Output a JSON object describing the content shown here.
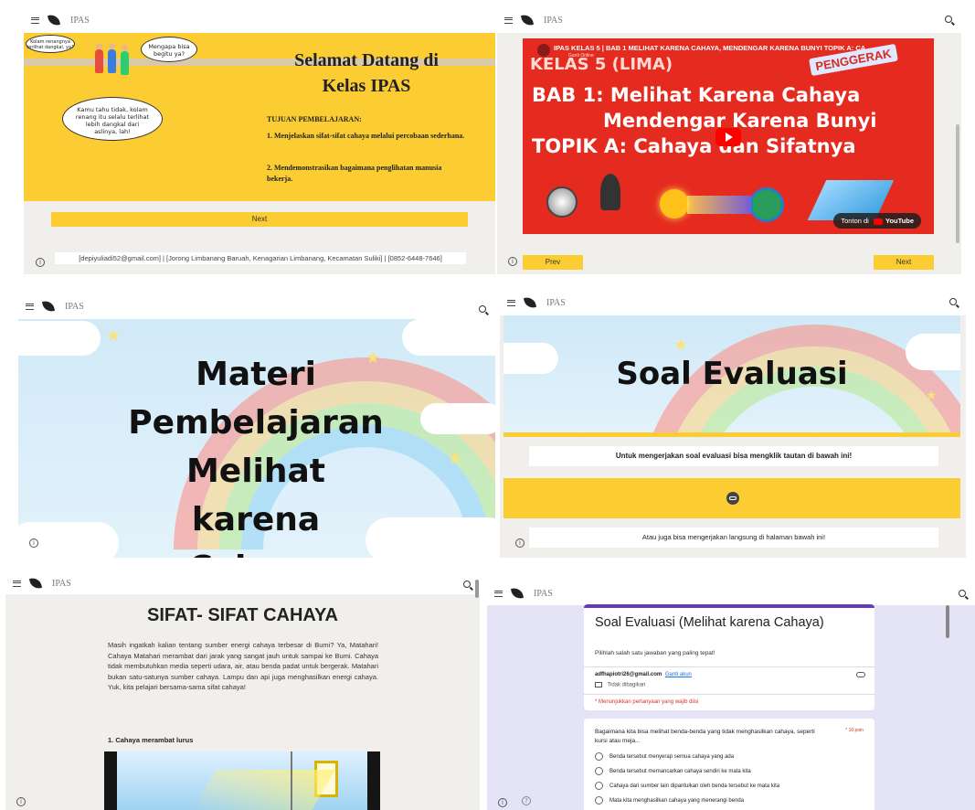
{
  "site": {
    "name": "IPAS"
  },
  "panel1": {
    "title": "Selamat Datang di Kelas IPAS",
    "objectives_heading": "TUJUAN PEMBELAJARAN:",
    "objectives": [
      "1. Menjelaskan sifat-sifat cahaya melalui percobaan sederhana.",
      "2. Mendemonstrasikan bagaimana penglihatan manusia bekerja."
    ],
    "bubbles": [
      "Kolam renangnya terlihat dangkal, ya?",
      "Mengapa bisa begitu ya?",
      "Kamu tahu tidak, kolam renang itu selalu terlihat lebih dangkal dari aslinya, lah!"
    ],
    "next_label": "Next",
    "footer": "[depiyuliadi52@gmail.com]  |  [Jorong Limbanang Baruah, Kenagarian Limbanang, Kecamatan Suliki]  |  [0852-6448-7646]"
  },
  "panel2": {
    "video_title": "IPAS KELAS 5 | BAB 1 MELIHAT KARENA CAHAYA, MENDENGAR KARENA BUNYI TOPIK A: CA",
    "channel": "Ganti Online",
    "badge": "KELAS 5 (LIMA)",
    "stamp": "PENGGERAK",
    "heading_lines": [
      "BAB 1: Melihat Karena Cahaya",
      "Mendengar Karena Bunyi",
      "TOPIK A: Cahaya dan Sifatnya"
    ],
    "watch_on": "Tonton di",
    "youtube": "YouTube",
    "prev_label": "Prev",
    "next_label": "Next"
  },
  "panel3": {
    "title_lines": [
      "Materi",
      "Pembelajaran",
      "Melihat",
      "karena Cahaya"
    ]
  },
  "panel4": {
    "title": "Soal Evaluasi",
    "instruction": "Untuk mengerjakan soal evaluasi bisa mengklik tautan di bawah ini!",
    "alt_text": "Atau juga bisa mengerjakan langsung di halaman bawah ini!"
  },
  "panel5": {
    "title": "SIFAT- SIFAT CAHAYA",
    "paragraph": "Masih ingatkah kalian tentang sumber energi cahaya terbesar di Bumi? Ya, Matahari! Cahaya Matahari merambat dari jarak yang sangat jauh untuk sampai ke Bumi. Cahaya tidak membutuhkan media seperti udara, air, atau benda padat untuk bergerak. Matahari bukan satu-satunya sumber cahaya. Lampu dan api juga menghasilkan energi cahaya. Yuk, kita pelajari bersama-sama sifat cahaya!",
    "subheading": "1. Cahaya merambat lurus"
  },
  "panel6": {
    "form_title": "Soal Evaluasi (Melihat karena Cahaya)",
    "form_desc": "Pilihlah salah satu jawaban yang paling tepat!",
    "account": "adfhapiotri26@gmail.com",
    "switch_account": "Ganti akun",
    "not_shared": "Tidak dibagikan",
    "required_note": "* Menunjukkan pertanyaan yang wajib diisi",
    "question": "Bagaimana kita bisa melihat benda-benda yang tidak menghasilkan cahaya, seperti kursi atau meja...",
    "points": "* 10 poin",
    "options": [
      "Benda tersebut menyerap semua cahaya yang ada",
      "Benda tersebut memancarkan cahaya sendiri ke mata kita",
      "Cahaya dari sumber lain dipantulkan oleh benda tersebut ke mata kita",
      "Mata kita menghasilkan cahaya yang menerangi benda"
    ]
  }
}
